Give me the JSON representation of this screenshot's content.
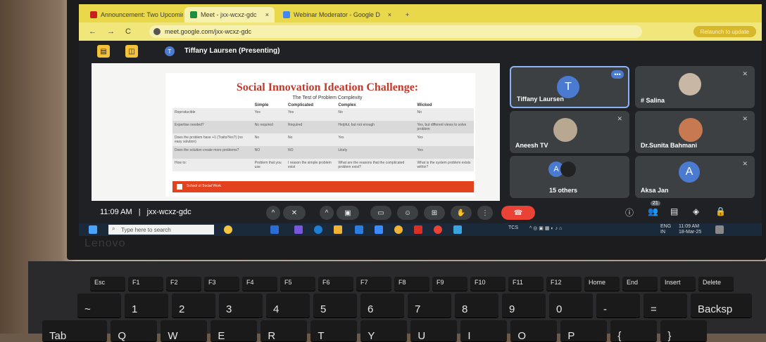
{
  "browser": {
    "tabs": [
      {
        "label": "Announcement: Two Upcoming",
        "close": "×"
      },
      {
        "label": "Meet - jxx-wcxz-gdc",
        "close": "×"
      },
      {
        "label": "Webinar Moderator - Google D",
        "close": "×"
      }
    ],
    "new_tab": "+",
    "url": "meet.google.com/jxx-wcxz-gdc",
    "relaunch": "Relaunch to update",
    "nav_back": "←",
    "nav_forward": "→",
    "nav_reload": "C"
  },
  "meet": {
    "presenter_initial": "T",
    "presenter": "Tiffany Laursen (Presenting)",
    "meeting_time": "11:09 AM",
    "meeting_code": "jxx-wcxz-gdc",
    "separator": "|",
    "participant_count": "21",
    "tiles": [
      {
        "name": "Tiffany Laursen",
        "initial": "T"
      },
      {
        "name": "# Salina"
      },
      {
        "name": "Aneesh TV"
      },
      {
        "name": "Dr.Sunita Bahmani"
      },
      {
        "name": "15 others",
        "initial": "A"
      },
      {
        "name": "Aksa Jan",
        "initial": "A"
      }
    ],
    "more_icon": "•••"
  },
  "slide": {
    "title": "Social Innovation Ideation Challenge:",
    "subtitle": "The Test of Problem Complexity",
    "columns": [
      "",
      "Simple",
      "Complicated",
      "Complex",
      "Wicked"
    ],
    "rows": [
      [
        "Reproducible",
        "Yes",
        "Yes",
        "No",
        "No"
      ],
      [
        "Expertise needed?",
        "No required",
        "Required",
        "Helpful, but not enough",
        "Yes, but different views to solve problem"
      ],
      [
        "Does the problem have +1 (Traits/Yes?) (no easy solution)",
        "No",
        "No",
        "Yes",
        "Yes"
      ],
      [
        "Does the solution create more problems?",
        "NO",
        "NO",
        "Likely",
        "Yes"
      ],
      [
        "How to:",
        "Problem that you use",
        "I reason the simple problem exist",
        "What are the reasons that the complicated problem exist?",
        "What is the system problem exists within?"
      ]
    ],
    "footer": "School of Social Work"
  },
  "taskbar": {
    "search_placeholder": "Type here to search",
    "tcs": "TCS",
    "lang": "ENG",
    "region": "IN",
    "clock": "11:09 AM",
    "date": "18-Mar-25"
  },
  "laptop_brand": "Lenovo",
  "keys": {
    "row0": [
      "Esc",
      "F1",
      "F2",
      "F3",
      "F4",
      "F5",
      "F6",
      "F7",
      "F8",
      "F9",
      "F10",
      "F11",
      "F12",
      "Home",
      "End",
      "Insert",
      "Delete"
    ],
    "row1": [
      "~",
      "1",
      "2",
      "3",
      "4",
      "5",
      "6",
      "7",
      "8",
      "9",
      "0",
      "-",
      "=",
      "Backsp"
    ],
    "row2": [
      "Tab",
      "Q",
      "W",
      "E",
      "R",
      "T",
      "Y",
      "U",
      "I",
      "O",
      "P",
      "{",
      "}"
    ]
  },
  "colors": {
    "tab_bar": "#e8d84a",
    "end_call": "#ea4335",
    "presenter_accent": "#f4c23b",
    "slide_title": "#c0392b"
  }
}
